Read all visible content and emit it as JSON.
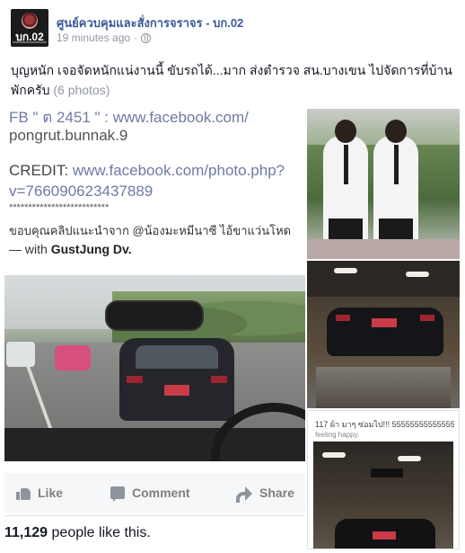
{
  "post": {
    "page_name": "ศูนย์ควบคุมและสั่งการจราจร - บก.02",
    "avatar_label": "บก.02",
    "time": "19 minutes ago",
    "time_separator": "·",
    "text": "บุญหนัก เจอจัดหนักแน่งานนี้ ขับรถได้...มาก ส่งตำรวจ สน.บางเขน ไปจัดการที่บ้านพักครับ",
    "photo_count": "(6 photos)"
  },
  "main_photo": {
    "fb_line": "FB \" ต 2451 \" : www.facebook.com/",
    "fb_handle": "pongrut.bunnak.9",
    "credit_label": "CREDIT:",
    "credit_url": "www.facebook.com/photo.php?",
    "credit_url2": "v=766090623437889",
    "stars": "**************************",
    "thanks": "ขอบคุณคลิปแนะนำจาก @น้องมะหมีนาซี ไอ้ขาแว่นโหด",
    "with_prefix": "— with",
    "with_name": "GustJung Dv."
  },
  "thumb3": {
    "caption": "117 ผ้า มาๆ ซ่อมไป!!! 555555555555555 —",
    "feeling": "feeling happy."
  },
  "actions": {
    "like": "Like",
    "comment": "Comment",
    "share": "Share"
  },
  "likes": {
    "count": "11,129",
    "suffix": "people like this."
  },
  "icons": {
    "like": "thumbs-up-icon",
    "comment": "speech-bubble-icon",
    "share": "share-arrow-icon",
    "privacy": "globe-icon"
  },
  "colors": {
    "link": "#3b5998",
    "muted": "#9197a3",
    "action_text": "#7f7f7f"
  }
}
